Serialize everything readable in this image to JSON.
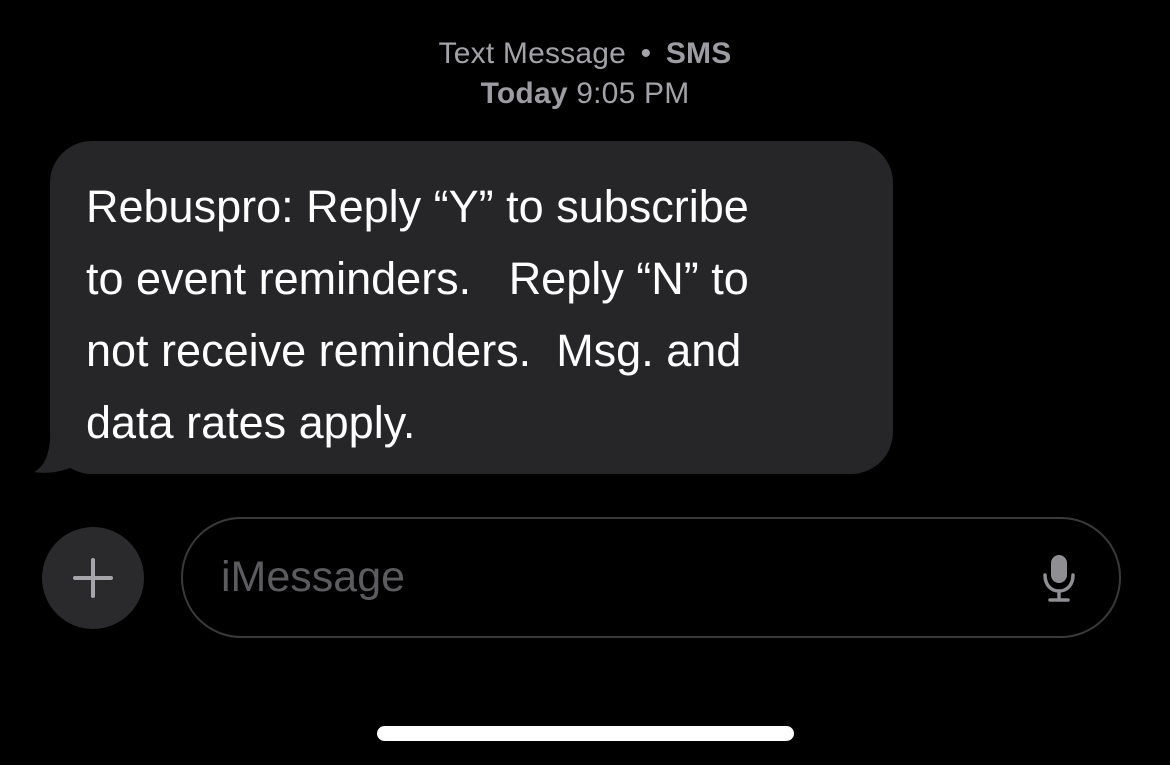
{
  "header": {
    "message_type": "Text Message",
    "separator": "•",
    "service": "SMS",
    "day": "Today",
    "time": "9:05 PM"
  },
  "messages": [
    {
      "direction": "incoming",
      "text": "Rebuspro: Reply “Y” to subscribe\nto event reminders.   Reply “N” to\nnot receive reminders.  Msg. and\ndata rates apply."
    }
  ],
  "composer": {
    "placeholder": "iMessage",
    "value": "",
    "add_icon": "plus-icon",
    "mic_icon": "microphone-icon"
  },
  "colors": {
    "background": "#000000",
    "bubble_incoming": "#262629",
    "header_text": "#a2a2a8",
    "placeholder": "#5c5c60",
    "icon": "#a5a5aa"
  }
}
